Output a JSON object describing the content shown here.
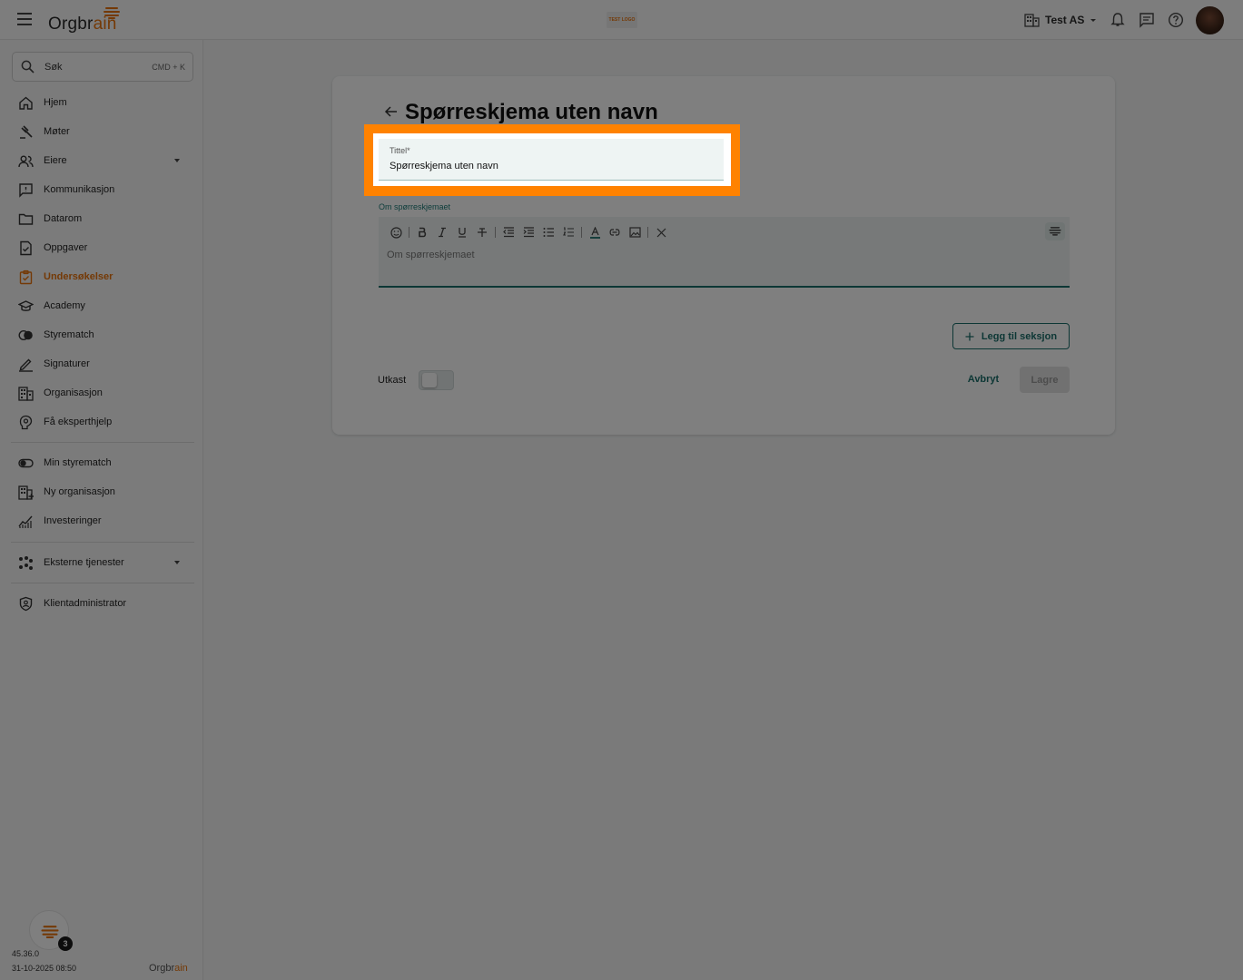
{
  "topbar": {
    "logo_text": "Orgbr",
    "logo_text_accent": "ain",
    "test_logo": "TEST LOGO",
    "org_name": "Test AS"
  },
  "search": {
    "label": "Søk",
    "shortcut": "CMD + K"
  },
  "sidebar": {
    "items": [
      {
        "label": "Hjem",
        "icon": "home-icon"
      },
      {
        "label": "Møter",
        "icon": "gavel-icon"
      },
      {
        "label": "Eiere",
        "icon": "people-icon"
      },
      {
        "label": "Kommunikasjon",
        "icon": "chat-icon"
      },
      {
        "label": "Datarom",
        "icon": "folder-icon"
      },
      {
        "label": "Oppgaver",
        "icon": "task-icon"
      },
      {
        "label": "Undersøkelser",
        "icon": "survey-icon"
      },
      {
        "label": "Academy",
        "icon": "graduation-cap-icon"
      },
      {
        "label": "Styrematch",
        "icon": "match-icon"
      },
      {
        "label": "Signaturer",
        "icon": "pen-icon"
      },
      {
        "label": "Organisasjon",
        "icon": "building-icon"
      },
      {
        "label": "Få eksperthjelp",
        "icon": "expert-icon"
      }
    ],
    "items2": [
      {
        "label": "Min styrematch",
        "icon": "toggle-icon"
      },
      {
        "label": "Ny organisasjon",
        "icon": "building-add-icon"
      },
      {
        "label": "Investeringer",
        "icon": "chart-icon"
      }
    ],
    "external": {
      "label": "Eksterne tjenester",
      "icon": "apps-icon"
    },
    "admin": {
      "label": "Klientadministrator",
      "icon": "shield-icon"
    },
    "active_color": "#e8730c"
  },
  "footer": {
    "badge": "3",
    "version": "45.36.0",
    "date": "31-10-2025 08:50",
    "logo_text": "Orgbr",
    "logo_text_accent": "ain"
  },
  "form": {
    "page_title": "Spørreskjema uten navn",
    "title_label": "Tittel*",
    "title_value": "Spørreskjema uten navn",
    "about_label": "Om spørreskjemaet",
    "about_placeholder": "Om spørreskjemaet",
    "add_section": "Legg til seksjon",
    "draft_label": "Utkast",
    "cancel": "Avbryt",
    "save": "Lagre",
    "accent_color": "#1a6e6a",
    "highlight_color": "#ff8200"
  }
}
